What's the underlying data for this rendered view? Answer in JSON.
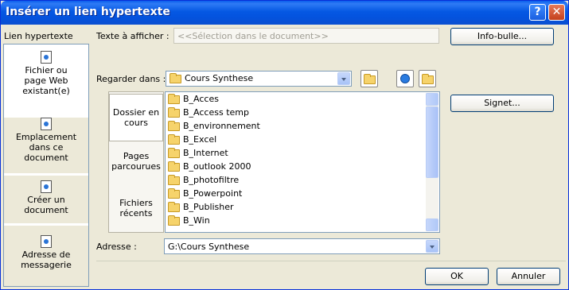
{
  "window": {
    "title": "Insérer un lien hypertexte",
    "help_glyph": "?",
    "close_glyph": "✕"
  },
  "side": {
    "label": "Lien hypertexte",
    "items": [
      {
        "line1": "Fichier ou",
        "line2": "page Web",
        "line3": "existant(e)",
        "icon": "web-page-icon"
      },
      {
        "line1": "Emplacement",
        "line2": "dans ce",
        "line3": "document",
        "icon": "place-in-doc-icon"
      },
      {
        "line1": "Créer un",
        "line2": "document",
        "line3": "",
        "icon": "new-doc-icon"
      },
      {
        "line1": "Adresse de",
        "line2": "messagerie",
        "line3": "",
        "icon": "email-icon"
      }
    ]
  },
  "display_text": {
    "label": "Texte à afficher :",
    "value": "<<Sélection dans le document>>"
  },
  "screentip_button": "Info-bulle...",
  "bookmark_button": "Signet...",
  "lookin": {
    "label": "Regarder dans :",
    "value": "Cours Synthese"
  },
  "nav": [
    {
      "line1": "Dossier en",
      "line2": "cours"
    },
    {
      "line1": "Pages",
      "line2": "parcourues"
    },
    {
      "line1": "Fichiers",
      "line2": "récents"
    }
  ],
  "files": [
    "B_Acces",
    "B_Access temp",
    "B_environnement",
    "B_Excel",
    "B_Internet",
    "B_outlook 2000",
    "B_photofiltre",
    "B_Powerpoint",
    "B_Publisher",
    "B_Win"
  ],
  "address": {
    "label": "Adresse :",
    "value": "G:\\Cours Synthese"
  },
  "ok_button": "OK",
  "cancel_button": "Annuler"
}
